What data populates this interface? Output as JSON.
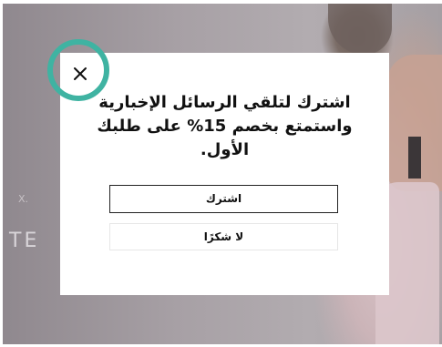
{
  "background": {
    "letters": "TE",
    "small_text": "X."
  },
  "popup": {
    "title": "اشترك لتلقي الرسائل الإخبارية واستمتع بخصم 15% على طلبك الأول.",
    "subscribe_label": "اشترك",
    "decline_label": "لا شكرًا",
    "close_icon": "close-icon"
  },
  "colors": {
    "highlight_ring": "#3fb3a2",
    "modal_background": "#ffffff",
    "text": "#111111"
  }
}
